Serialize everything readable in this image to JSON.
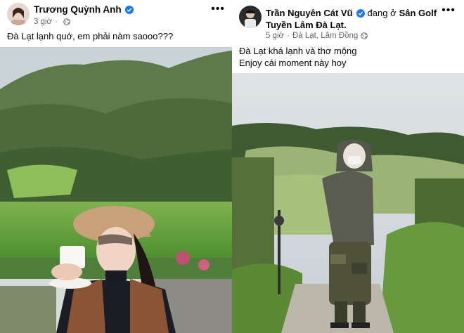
{
  "left_post": {
    "author": "Trương Quỳnh Anh",
    "verified": true,
    "time": "3 giờ",
    "privacy_icon": "globe-icon",
    "caption": "Đà Lạt lạnh quớ, em phải nàm saooo???",
    "more_icon": "more-horizontal-icon"
  },
  "right_post": {
    "author": "Trần Nguyên Cát Vũ",
    "verified": true,
    "checkin_prefix": "đang ở",
    "place_part1": "Sân Golf",
    "place_part2": "Tuyền Lâm Đà Lạt.",
    "time": "5 giờ",
    "location": "Đà Lạt, Lâm Đồng",
    "privacy_icon": "globe-icon",
    "caption_line1": "Đà Lạt khá lạnh và thơ mộng",
    "caption_line2": "Enjoy cái moment này hoy",
    "more_icon": "more-horizontal-icon"
  },
  "colors": {
    "verified_blue": "#1877f2",
    "meta_gray": "#65676b"
  }
}
